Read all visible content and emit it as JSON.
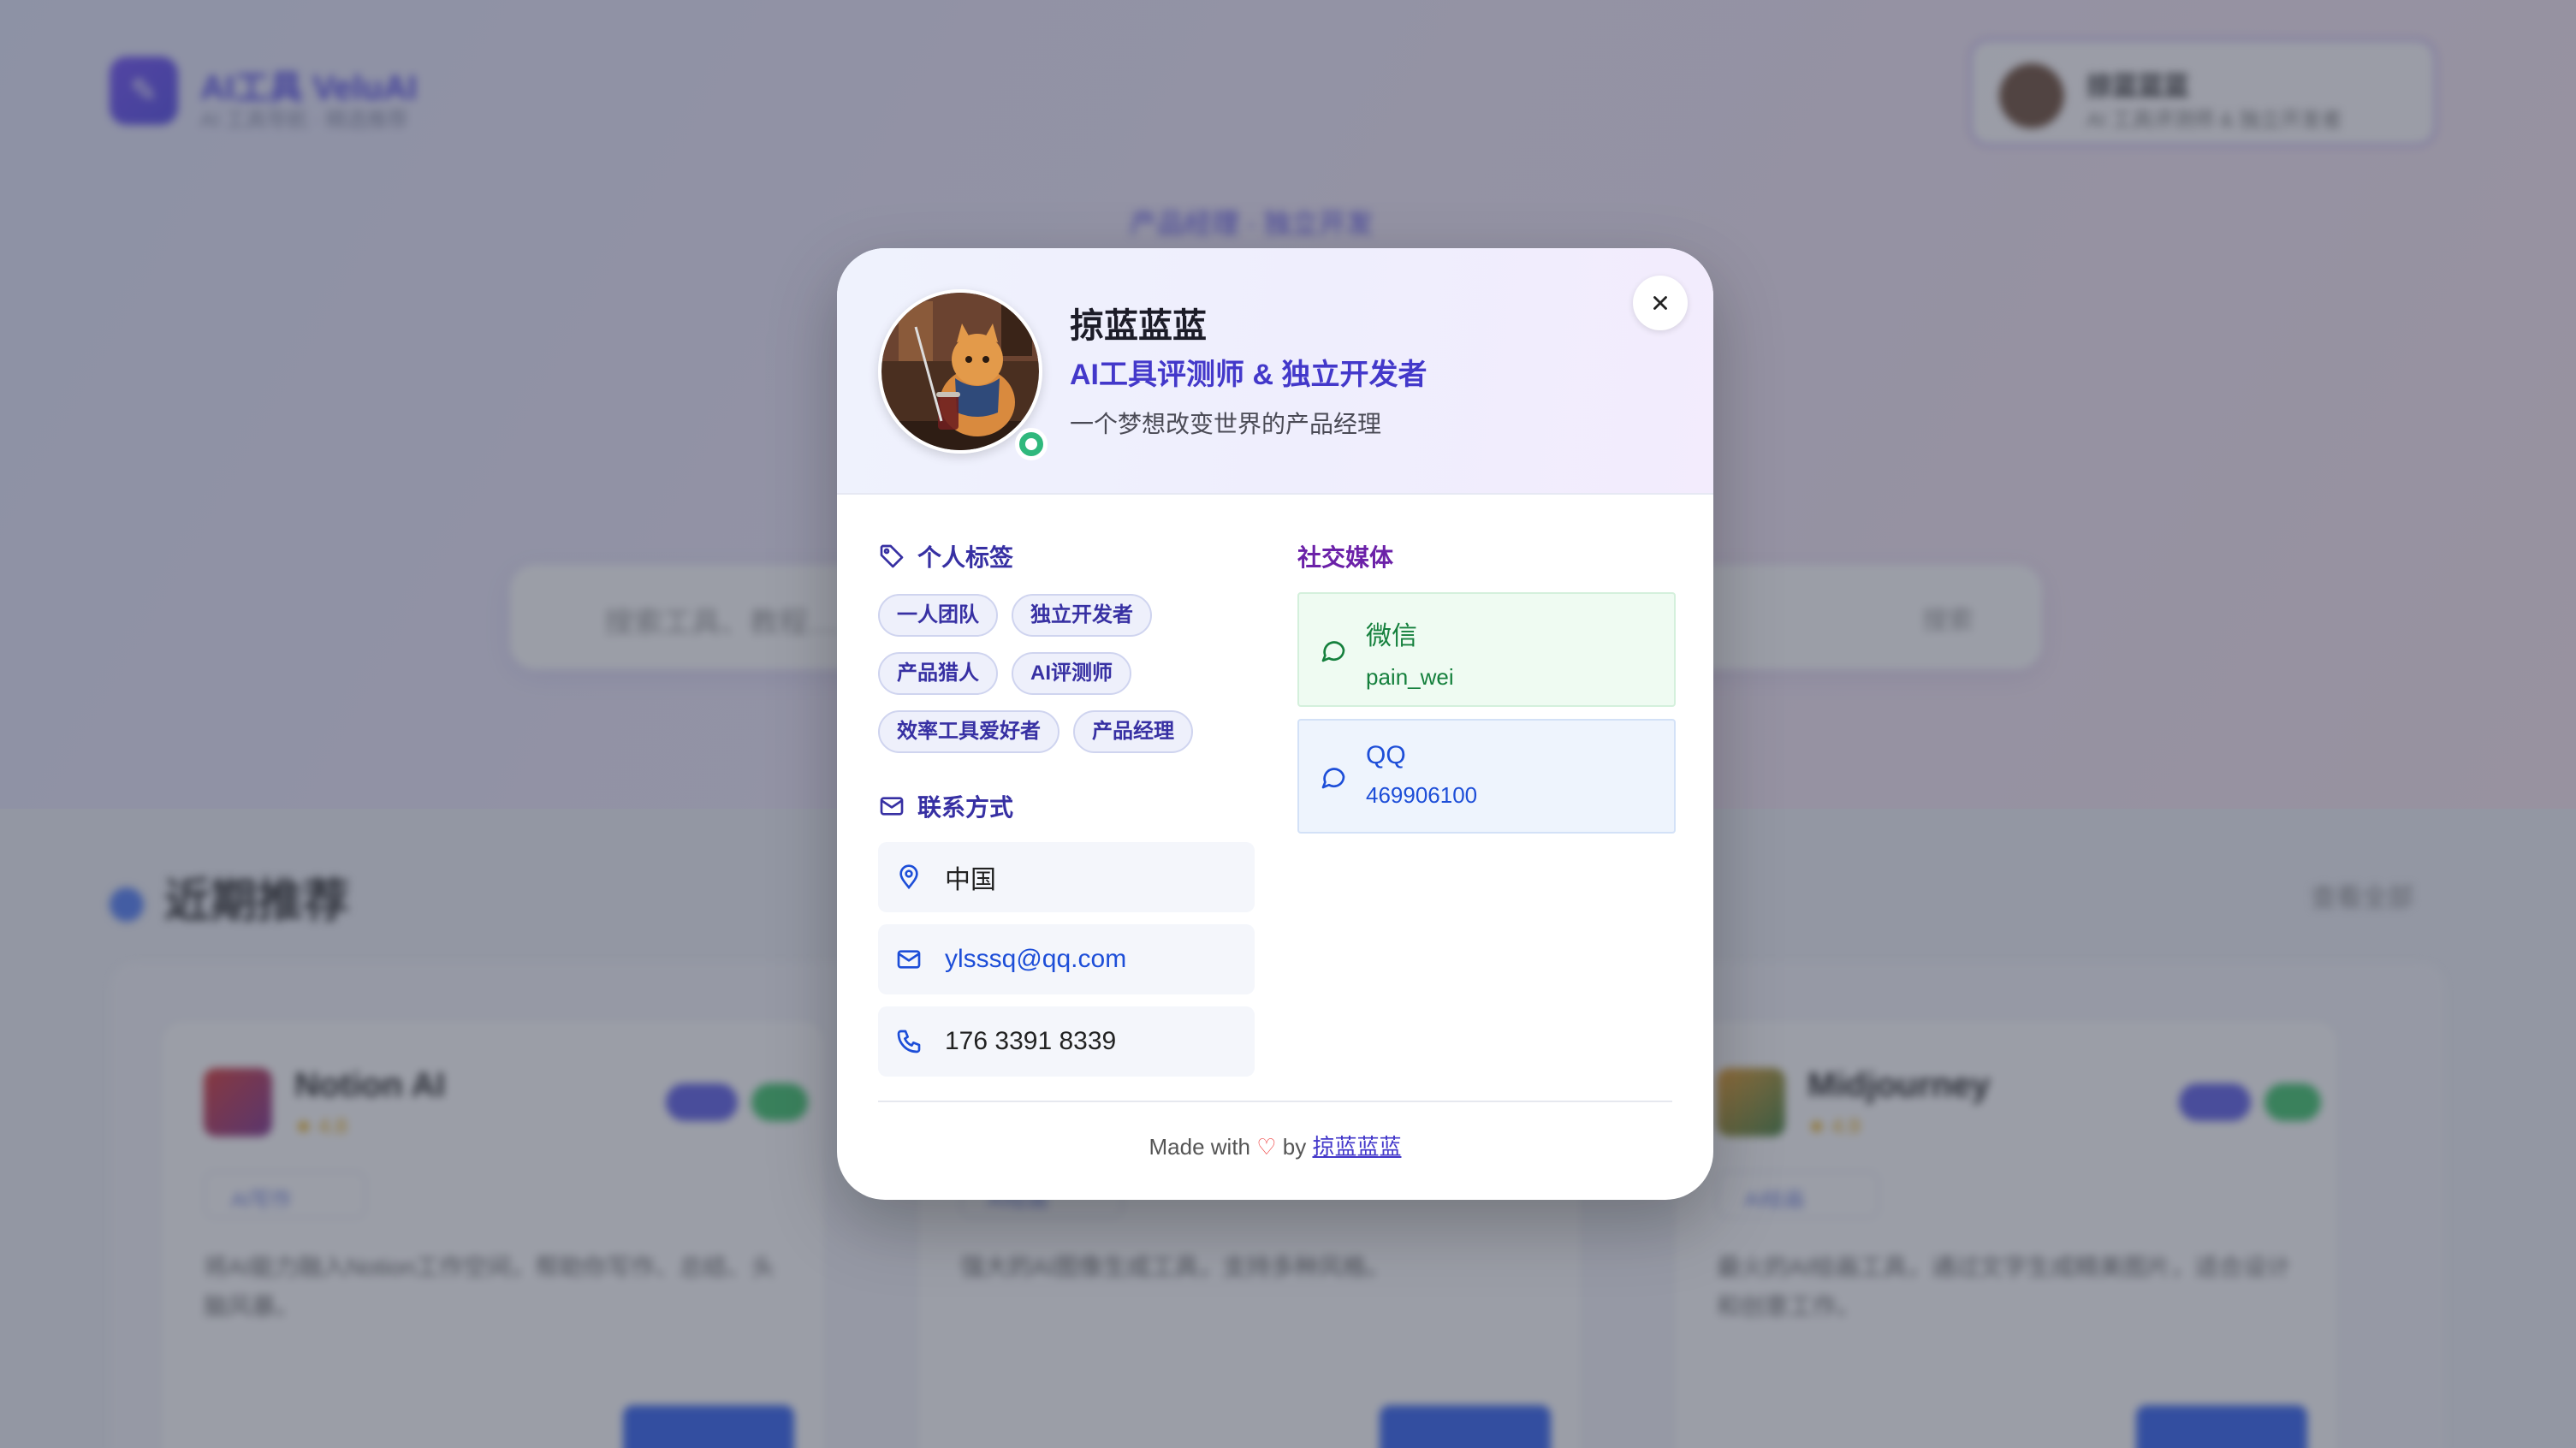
{
  "background": {
    "logo": {
      "name": "AI工具 VeluAI",
      "subtitle": "AI 工具导航 · 精选推荐"
    },
    "user": {
      "name": "掠蓝蓝蓝",
      "desc": "AI 工具评测师 & 独立开发者"
    },
    "hero_badge": "产品经理 · 独立开发",
    "search": {
      "placeholder": "搜索工具、教程……",
      "button": "搜索"
    },
    "section": {
      "title": "近期推荐",
      "more": "查看全部"
    },
    "cards": [
      {
        "title": "Notion AI",
        "rating": "★ 4.8",
        "chip": "AI写作",
        "desc": "将AI能力融入Notion工作空间，帮助你写作、总结、头脑风暴。"
      },
      {
        "title": "",
        "rating": "",
        "chip": "AI绘画",
        "desc": "强大的AI图像生成工具，支持多种风格。"
      },
      {
        "title": "Midjourney",
        "rating": "★ 4.9",
        "chip": "AI绘画",
        "desc": "最火的AI绘画工具，通过文字生成精美图片，适合设计和创意工作。"
      }
    ]
  },
  "modal": {
    "name": "掠蓝蓝蓝",
    "title": "AI工具评测师 & 独立开发者",
    "motto": "一个梦想改变世界的产品经理",
    "status": "online",
    "tags_heading": "个人标签",
    "tags": [
      "一人团队",
      "独立开发者",
      "产品猎人",
      "AI评测师",
      "效率工具爱好者",
      "产品经理"
    ],
    "contact_heading": "联系方式",
    "contact": {
      "location": "中国",
      "email": "ylsssq@qq.com",
      "phone": "176 3391 8339"
    },
    "social_heading": "社交媒体",
    "social": [
      {
        "label": "微信",
        "value": "pain_wei"
      },
      {
        "label": "QQ",
        "value": "469906100"
      }
    ],
    "footer": {
      "made_with": "Made with",
      "by": "by",
      "author": "掠蓝蓝蓝"
    }
  },
  "colors": {
    "accent": "#4338ca",
    "accent_purple": "#6b21a8",
    "online": "#2fb87c",
    "wechat": "#15803d",
    "qq": "#1d4ed8",
    "heart": "#ef4444"
  },
  "icons": [
    "tag-icon",
    "mail-icon",
    "map-pin-icon",
    "phone-icon",
    "chat-bubble-icon",
    "close-icon",
    "heart-icon"
  ]
}
